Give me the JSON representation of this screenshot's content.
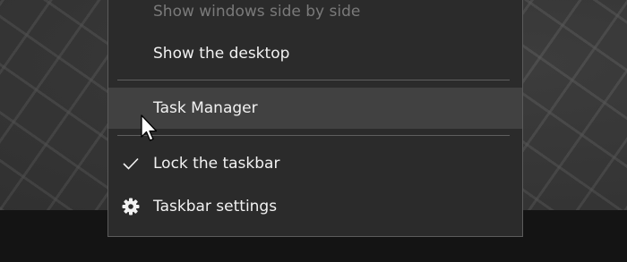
{
  "context_menu": {
    "items": [
      {
        "label": "Show windows side by side",
        "state": "disabled"
      },
      {
        "label": "Show the desktop",
        "state": "normal"
      },
      {
        "label": "Task Manager",
        "state": "hovered"
      },
      {
        "label": "Lock the taskbar",
        "state": "checked",
        "icon": "checkmark-icon"
      },
      {
        "label": "Taskbar settings",
        "state": "normal",
        "icon": "gear-icon"
      }
    ]
  },
  "colors": {
    "menu_background": "#2b2b2b",
    "hover_background": "#414141",
    "text": "#f2f2f2",
    "disabled_text": "#7a7a7a",
    "taskbar": "#141414"
  }
}
